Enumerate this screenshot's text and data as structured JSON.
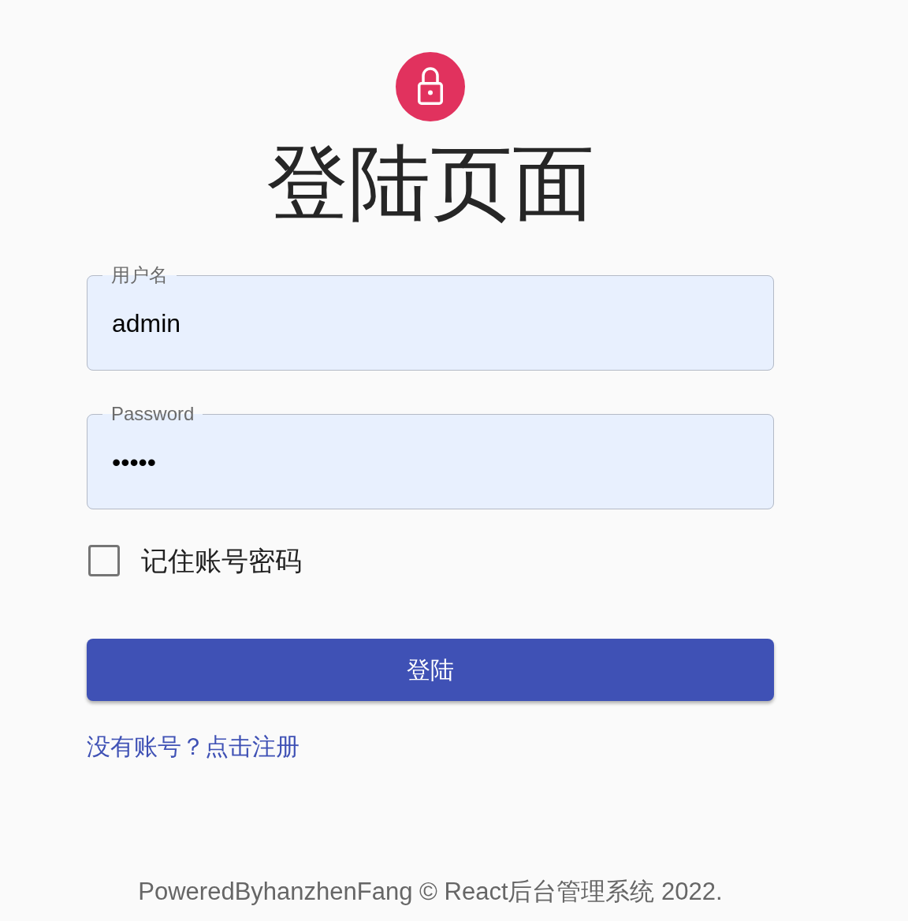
{
  "title": "登陆页面",
  "fields": [
    {
      "label": "用户名",
      "value": "admin"
    },
    {
      "label": "Password",
      "value": "•••••"
    }
  ],
  "remember": {
    "label": "记住账号密码",
    "checked": false
  },
  "submit_button": {
    "label": "登陆"
  },
  "register_link": {
    "label": "没有账号？点击注册"
  },
  "footer": {
    "text": "PoweredByhanzhenFang © React后台管理系统 2022."
  }
}
